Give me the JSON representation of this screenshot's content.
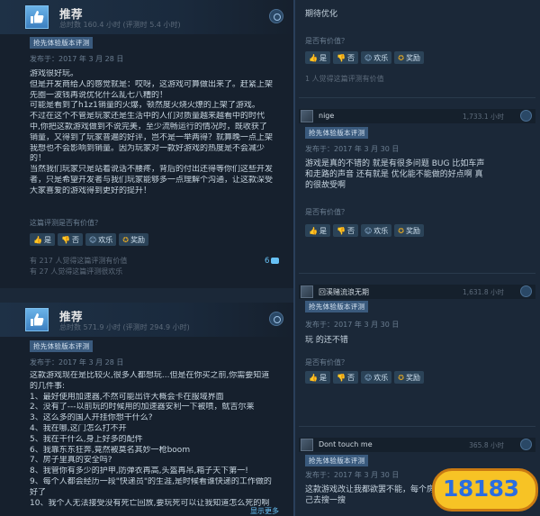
{
  "left": {
    "review1": {
      "title": "推荐",
      "hours": "总时数 160.4 小时 (评测时 5.4 小时)",
      "badge": "抢先体验版本评测",
      "posted": "发布于：2017 年 3 月 28 日",
      "lines": [
        "游戏很好玩。",
        "但是开发商给人的感觉就是：哎呀，这游戏可算做出来了。赶紧上架",
        "先圈一波钱再说优化什么乱七八糟的！",
        "可能是看到了h1z1销量的火爆，顿然度火烧火燎的上架了游戏。",
        "不过在这个不管是玩家还是生活中的人们对质量越来越看中的时代",
        "中,你把这款游戏做到不说完美，至少流畅运行的情况时，既收获了",
        "销量，又得到了玩家普遍的好评，岂不是一举两得？就算晚一点上架",
        "我想也不会影响到销量。因为玩家对一款好游戏的热度是不会减少",
        "的！",
        "当然我们玩家只是站着说话不腰疼，背后的付出还得等你们这些开发",
        "者，只是希望开发者与我们玩家能够多一点理解个沟通，让这款深受",
        "大家喜爱的游戏得到更好的提升！"
      ],
      "helpful_q": "这篇评测是否有价值？",
      "buttons": [
        "是",
        "否",
        "欢乐",
        "奖励"
      ],
      "stat1": "有 217 人觉得这篇评测有价值",
      "stat2": "有 27 人觉得这篇评测很欢乐",
      "comments": "6"
    },
    "review2": {
      "title": "推荐",
      "hours": "总时数 571.9 小时 (评测时 294.9 小时)",
      "badge": "抢先体验版本评测",
      "posted": "发布于：2017 年 3 月 28 日",
      "lines": [
        "这款游戏现在是比较火,很多人都想玩...但是在你买之前,你需要知道",
        "的几件事:",
        "1、最好使用加速器,不然可能出许大概会卡在服域界面",
        "2、没有了---以前玩的时候用的加速器安利一下被喷，鱿吉尔莱",
        "3、这么多的国人开挂你想干什么?",
        "4、我在哪,这门怎么打不开",
        "5、我在干什么,身上好多的配件",
        "6、我靠东东狂奔,竟然被莫名其妙一枪boom",
        "7、房子里真的安全吗?",
        "8、我管你有多少的护甲,防弹衣再高,头盔再吊,箱子天下第一!",
        "9、每个人都会经历一段\"快递员\"的生涯,是时候看谁快递的工作做的",
        "好了",
        "10、我个人无法接受没有死亡回放,要玩死可以让我知道怎么死的啊"
      ],
      "more": "显示更多"
    }
  },
  "right": {
    "top_text": "期待优化",
    "helpful_q1": "是否有价值？",
    "buttons": [
      "是",
      "否",
      "欢乐",
      "奖励"
    ],
    "stat_a": "1 人觉得这篇评测有价值",
    "c1": {
      "name": "nige",
      "hours": "1,733.1 小时",
      "badge": "抢先体验版本评测",
      "posted": "发布于：2017 年 3 月 30 日",
      "lines": [
        "游戏是真的不错的 就是有很多问题 BUG 比如车声",
        "和走路的声音 还有就是 优化能不能做的好点啊 真",
        "的很故受啊"
      ]
    },
    "c2": {
      "name": "回溪赌流浪无期",
      "hours": "1,631.8 小时",
      "badge": "抢先体验版本评测",
      "posted": "发布于：2017 年 3 月 30 日",
      "lines": [
        "玩 的还不错"
      ]
    },
    "c3": {
      "name": "Dont touch me",
      "hours": "365.8 小时",
      "badge": "抢先体验版本评测",
      "posted": "发布于：2017 年 3 月 30 日",
      "lines": [
        "这款游戏改让我都欲罢不能，每个房间",
        "己去搜一搜"
      ]
    }
  },
  "watermark": {
    "text": "18183"
  },
  "colors": {
    "bg": "#1b2838",
    "card": "#16202d",
    "accent": "#67c1f5",
    "badge": "#3a5a7d"
  }
}
